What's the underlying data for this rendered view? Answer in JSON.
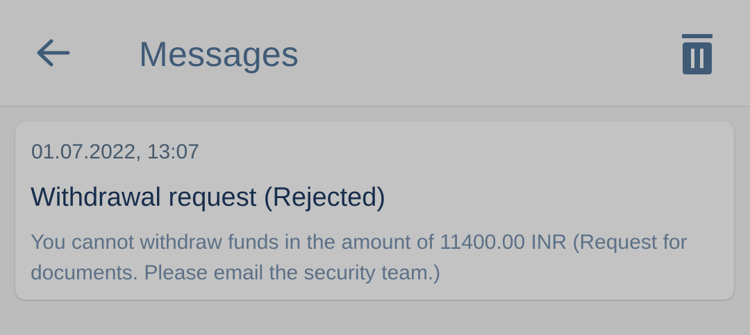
{
  "colors": {
    "background": "#bcbcbc",
    "header_text": "#3f5b77",
    "title_text": "#172d4c",
    "body_text": "#5c7087",
    "date_text": "#475a6c"
  },
  "header": {
    "title": "Messages",
    "back_icon": "arrow-left-icon",
    "delete_icon": "trash-icon"
  },
  "messages": [
    {
      "date": "01.07.2022, 13:07",
      "title": "Withdrawal request (Rejected)",
      "body": "You cannot withdraw funds in the amount of 11400.00 INR (Request for documents. Please email the security team.)"
    }
  ]
}
